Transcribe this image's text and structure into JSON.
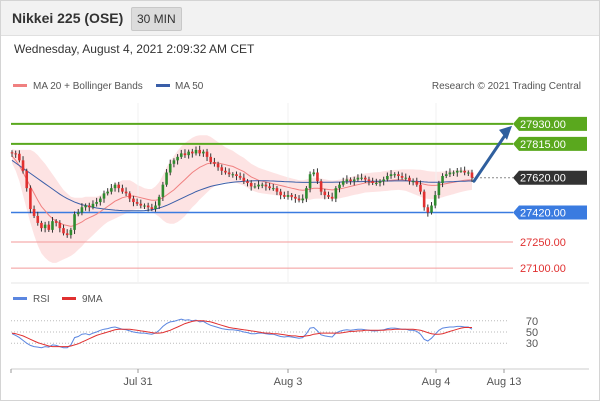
{
  "header": {
    "title": "Nikkei 225 (OSE)",
    "interval": "30 MIN",
    "timestamp": "Wednesday, August 4, 2021 2:09:32 AM CET"
  },
  "legend": {
    "ma20": "MA 20 + Bollinger Bands",
    "ma50": "MA 50",
    "credit": "Research © 2021 Trading Central",
    "rsi": "RSI",
    "rsi_ma": "9MA"
  },
  "colors": {
    "up": "#2e8b2e",
    "down": "#e03030",
    "ma20": "#f08080",
    "ma50": "#3a5ea8",
    "bollinger_fill": "#fddede",
    "resistance": "#5aa81e",
    "support": "#3a7be0",
    "weak_level": "#f39a9a",
    "last_price_box": "#333333",
    "arrow": "#2f5f9e",
    "rsi_line": "#5b86e0",
    "rsi_ma_line": "#e03030"
  },
  "chart_data": [
    {
      "type": "candlestick",
      "name": "price",
      "ylim": [
        27020,
        28050
      ],
      "x_ticks": [
        "Jul 31",
        "Aug 3",
        "Aug 4",
        "Aug 13"
      ],
      "levels": [
        {
          "label": "27930.00",
          "value": 27930,
          "style": "resistance"
        },
        {
          "label": "27815.00",
          "value": 27815,
          "style": "resistance"
        },
        {
          "label": "27620.00",
          "value": 27620,
          "style": "last"
        },
        {
          "label": "27420.00",
          "value": 27420,
          "style": "support"
        },
        {
          "label": "27250.00",
          "value": 27250,
          "style": "weak"
        },
        {
          "label": "27100.00",
          "value": 27100,
          "style": "weak"
        }
      ],
      "last_price": 27620,
      "forecast_arrow": {
        "from": 27600,
        "to": 27930
      },
      "close": [
        27760,
        27758,
        27720,
        27660,
        27560,
        27440,
        27400,
        27360,
        27330,
        27350,
        27320,
        27370,
        27360,
        27330,
        27300,
        27290,
        27320,
        27410,
        27420,
        27450,
        27460,
        27450,
        27470,
        27480,
        27500,
        27530,
        27540,
        27560,
        27580,
        27560,
        27540,
        27530,
        27500,
        27480,
        27470,
        27460,
        27460,
        27450,
        27440,
        27460,
        27510,
        27580,
        27650,
        27700,
        27720,
        27740,
        27760,
        27750,
        27770,
        27760,
        27780,
        27760,
        27770,
        27740,
        27710,
        27700,
        27680,
        27660,
        27650,
        27640,
        27640,
        27630,
        27620,
        27600,
        27590,
        27570,
        27570,
        27580,
        27580,
        27570,
        27560,
        27560,
        27540,
        27520,
        27510,
        27520,
        27510,
        27500,
        27490,
        27500,
        27560,
        27640,
        27650,
        27600,
        27540,
        27520,
        27510,
        27500,
        27560,
        27580,
        27600,
        27610,
        27600,
        27610,
        27620,
        27620,
        27610,
        27600,
        27590,
        27590,
        27600,
        27610,
        27630,
        27640,
        27640,
        27630,
        27620,
        27620,
        27600,
        27600,
        27580,
        27540,
        27450,
        27420,
        27460,
        27520,
        27590,
        27630,
        27640,
        27650,
        27650,
        27660,
        27660,
        27650,
        27650,
        27620
      ],
      "ma20": [
        27745,
        27720,
        27690,
        27650,
        27610,
        27570,
        27530,
        27490,
        27455,
        27430,
        27405,
        27385,
        27370,
        27360,
        27350,
        27345,
        27340,
        27345,
        27355,
        27365,
        27380,
        27390,
        27400,
        27410,
        27425,
        27440,
        27455,
        27470,
        27485,
        27495,
        27505,
        27510,
        27515,
        27515,
        27510,
        27505,
        27500,
        27495,
        27490,
        27490,
        27495,
        27505,
        27520,
        27535,
        27550,
        27570,
        27590,
        27610,
        27630,
        27650,
        27665,
        27680,
        27690,
        27700,
        27705,
        27705,
        27705,
        27700,
        27695,
        27690,
        27685,
        27675,
        27665,
        27655,
        27640,
        27625,
        27615,
        27605,
        27600,
        27595,
        27590,
        27585,
        27580,
        27575,
        27570,
        27565,
        27560,
        27555,
        27550,
        27548,
        27550,
        27555,
        27560,
        27560,
        27558,
        27555,
        27552,
        27550,
        27552,
        27555,
        27560,
        27565,
        27570,
        27575,
        27580,
        27585,
        27590,
        27592,
        27594,
        27595,
        27597,
        27600,
        27602,
        27605,
        27607,
        27608,
        27608,
        27606,
        27602,
        27598,
        27593,
        27588,
        27582,
        27578,
        27576,
        27576,
        27578,
        27582,
        27586,
        27590,
        27594,
        27598,
        27602,
        27605,
        27607,
        27608
      ],
      "bollinger_width": [
        40,
        60,
        90,
        130,
        170,
        210,
        240,
        260,
        270,
        270,
        265,
        255,
        240,
        220,
        200,
        185,
        170,
        160,
        150,
        140,
        130,
        120,
        110,
        100,
        95,
        90,
        90,
        95,
        100,
        100,
        100,
        95,
        90,
        80,
        70,
        65,
        60,
        60,
        65,
        80,
        100,
        130,
        160,
        180,
        195,
        205,
        210,
        210,
        205,
        200,
        195,
        185,
        175,
        165,
        150,
        135,
        120,
        110,
        100,
        95,
        90,
        85,
        82,
        80,
        78,
        76,
        74,
        72,
        70,
        68,
        66,
        64,
        62,
        60,
        58,
        57,
        56,
        56,
        56,
        58,
        60,
        62,
        62,
        60,
        58,
        56,
        55,
        54,
        54,
        54,
        54,
        54,
        54,
        54,
        55,
        55,
        55,
        55,
        56,
        56,
        56,
        57,
        58,
        58,
        58,
        58,
        60,
        62,
        66,
        70,
        74,
        78,
        80,
        80,
        80,
        78,
        76,
        74,
        72,
        70,
        68,
        66,
        64,
        62,
        60,
        58
      ],
      "ma50": [
        27720,
        27705,
        27690,
        27675,
        27660,
        27645,
        27630,
        27615,
        27600,
        27585,
        27570,
        27555,
        27540,
        27525,
        27512,
        27500,
        27490,
        27480,
        27472,
        27465,
        27460,
        27455,
        27450,
        27446,
        27443,
        27440,
        27438,
        27436,
        27434,
        27432,
        27431,
        27430,
        27430,
        27430,
        27430,
        27430,
        27431,
        27433,
        27436,
        27440,
        27446,
        27453,
        27461,
        27470,
        27480,
        27490,
        27500,
        27510,
        27520,
        27530,
        27540,
        27548,
        27556,
        27563,
        27570,
        27575,
        27580,
        27584,
        27588,
        27591,
        27594,
        27596,
        27598,
        27600,
        27601,
        27602,
        27603,
        27603,
        27603,
        27603,
        27602,
        27601,
        27600,
        27599,
        27598,
        27597,
        27596,
        27595,
        27594,
        27593,
        27593,
        27593,
        27594,
        27594,
        27594,
        27594,
        27594,
        27594,
        27595,
        27595,
        27596,
        27596,
        27597,
        27597,
        27598,
        27598,
        27599,
        27599,
        27600,
        27600,
        27600,
        27601,
        27601,
        27601,
        27602,
        27602,
        27602,
        27602,
        27601,
        27600,
        27599,
        27598,
        27596,
        27595,
        27594,
        27594,
        27594,
        27595,
        27596,
        27597,
        27598,
        27599,
        27600,
        27600,
        27601,
        27601
      ]
    },
    {
      "type": "line",
      "name": "rsi",
      "ylim": [
        0,
        100
      ],
      "y_ticks": [
        70,
        50,
        30
      ],
      "series": [
        {
          "name": "RSI",
          "values": [
            47,
            44,
            40,
            35,
            30,
            26,
            24,
            23,
            22,
            24,
            23,
            27,
            26,
            24,
            22,
            22,
            27,
            40,
            42,
            46,
            47,
            45,
            48,
            50,
            53,
            55,
            56,
            58,
            59,
            57,
            55,
            54,
            52,
            50,
            49,
            48,
            48,
            47,
            46,
            48,
            53,
            60,
            65,
            68,
            69,
            71,
            73,
            71,
            72,
            70,
            71,
            68,
            69,
            65,
            62,
            60,
            58,
            56,
            55,
            54,
            54,
            53,
            52,
            50,
            49,
            47,
            47,
            48,
            48,
            47,
            46,
            46,
            44,
            42,
            41,
            42,
            41,
            40,
            39,
            40,
            47,
            57,
            58,
            52,
            45,
            43,
            42,
            41,
            48,
            51,
            53,
            54,
            53,
            54,
            55,
            55,
            54,
            53,
            52,
            52,
            53,
            54,
            56,
            57,
            57,
            56,
            55,
            55,
            53,
            53,
            51,
            46,
            37,
            34,
            39,
            46,
            53,
            57,
            58,
            59,
            59,
            60,
            60,
            59,
            59,
            55
          ]
        },
        {
          "name": "9MA",
          "values": [
            48,
            47,
            45,
            43,
            40,
            37,
            34,
            31,
            29,
            27,
            25,
            24,
            24,
            24,
            24,
            24,
            25,
            27,
            29,
            32,
            35,
            38,
            41,
            44,
            46,
            48,
            50,
            52,
            54,
            55,
            55,
            55,
            55,
            54,
            53,
            52,
            51,
            50,
            49,
            48,
            48,
            49,
            51,
            53,
            56,
            59,
            62,
            65,
            67,
            69,
            70,
            70,
            70,
            69,
            68,
            66,
            64,
            62,
            60,
            58,
            57,
            56,
            55,
            54,
            53,
            52,
            51,
            50,
            49,
            48,
            48,
            47,
            47,
            46,
            45,
            44,
            43,
            43,
            42,
            42,
            43,
            44,
            46,
            47,
            48,
            48,
            48,
            48,
            48,
            48,
            49,
            50,
            51,
            51,
            52,
            52,
            53,
            53,
            53,
            53,
            53,
            53,
            54,
            54,
            55,
            55,
            55,
            55,
            55,
            55,
            54,
            53,
            51,
            49,
            47,
            46,
            46,
            47,
            49,
            51,
            53,
            55,
            57,
            58,
            58,
            58
          ]
        }
      ]
    }
  ]
}
